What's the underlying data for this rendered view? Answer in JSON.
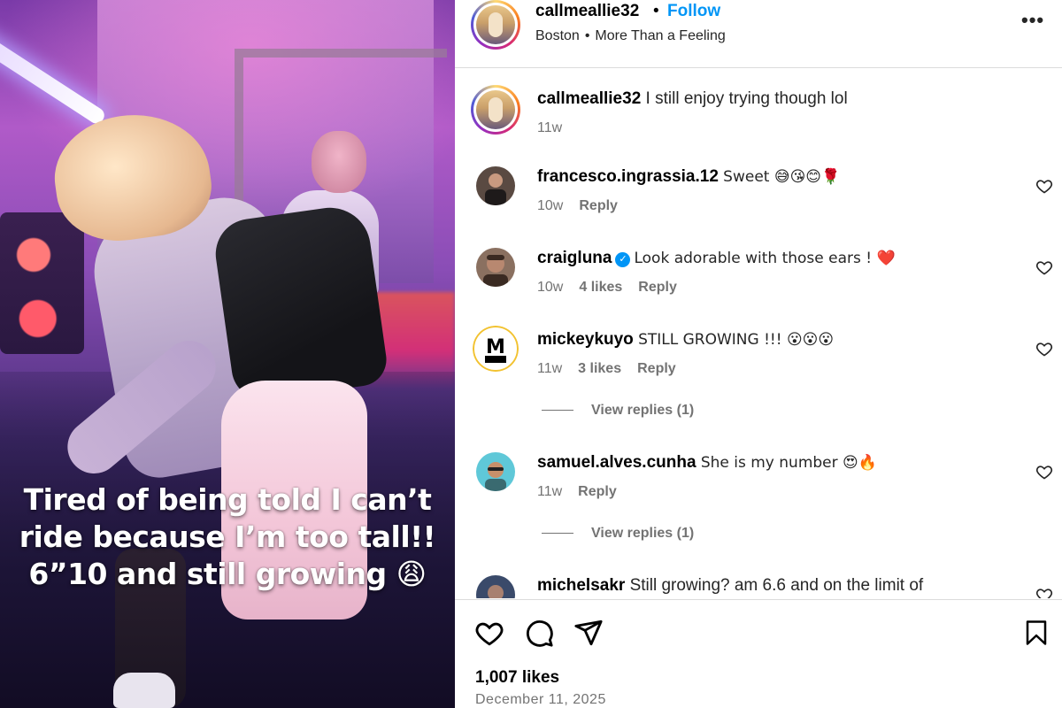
{
  "media": {
    "caption_lines": [
      "Tired of being told I can’t",
      "ride because I’m too tall!!",
      "6”10 and still growing 😩"
    ]
  },
  "header": {
    "username": "callmeallie32",
    "separator": "•",
    "follow_label": "Follow",
    "location": "Boston",
    "audio": "More Than a Feeling",
    "more_label": "•••"
  },
  "comments": [
    {
      "username": "callmeallie32",
      "text": "I still enjoy trying though lol",
      "age": "11w",
      "likes": "",
      "reply_label": "",
      "view_replies": ""
    },
    {
      "username": "francesco.ingrassia.12",
      "text": "Sweet 😅😘😊🌹",
      "age": "10w",
      "likes": "",
      "reply_label": "Reply",
      "view_replies": ""
    },
    {
      "username": "craigluna",
      "verified": true,
      "text": "Look adorable with those ears ! ❤️",
      "age": "10w",
      "likes": "4 likes",
      "reply_label": "Reply",
      "view_replies": ""
    },
    {
      "username": "mickeykuyo",
      "text": "STILL GROWING !!! 😮😮😮",
      "age": "11w",
      "likes": "3 likes",
      "reply_label": "Reply",
      "view_replies": "View replies (1)"
    },
    {
      "username": "samuel.alves.cunha",
      "text": "She is my number 😍🔥",
      "age": "11w",
      "likes": "",
      "reply_label": "Reply",
      "view_replies": "View replies (1)"
    },
    {
      "username": "michelsakr",
      "text": "Still growing? am 6.6 and on the limit of",
      "age": "",
      "likes": "",
      "reply_label": "",
      "view_replies": ""
    }
  ],
  "actions": {
    "likes": "1,007 likes",
    "date": "December 11, 2025"
  },
  "colors": {
    "link_blue": "#0095f6",
    "verified_blue": "#0095f6",
    "muted_gray": "#737373",
    "heart_red": "#e0245e"
  },
  "icons": [
    "heart-icon",
    "comment-icon",
    "share-icon",
    "bookmark-icon",
    "more-icon",
    "verified-icon"
  ]
}
